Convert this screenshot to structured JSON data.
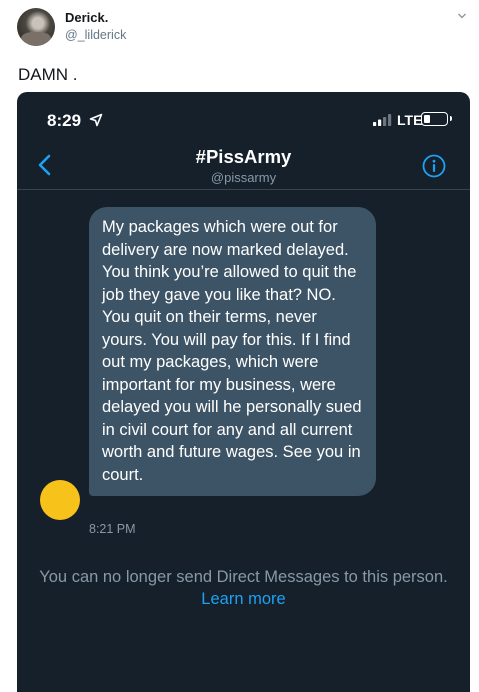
{
  "tweet": {
    "author_name": "Derick.",
    "author_handle": "@_lilderick",
    "text": "DAMN ."
  },
  "phone_screenshot": {
    "status_bar": {
      "time": "8:29",
      "network": "LTE"
    },
    "conversation": {
      "title": "#PissArmy",
      "handle": "@pissarmy"
    },
    "message": {
      "text": "My packages which were out for delivery are now marked delayed. You think you’re allowed to quit the job they gave you like that? NO. You quit on their terms, never yours. You will pay for this. If I find out my packages, which were important for my business, were delayed you will he personally sued in civil court for any and all current worth and future wages. See you in court.",
      "time": "8:21 PM"
    },
    "notice": {
      "text": "You can no longer send Direct Messages to this person.",
      "link": "Learn more"
    }
  },
  "colors": {
    "screenshot_background": "#15202b",
    "bubble": "#3d5466",
    "link_blue": "#1da1f2",
    "dm_avatar": "#f7c21a"
  },
  "icons": [
    "chevron-down-icon",
    "location-arrow-icon",
    "signal-bars-icon",
    "battery-icon",
    "back-chevron-icon",
    "info-icon"
  ]
}
